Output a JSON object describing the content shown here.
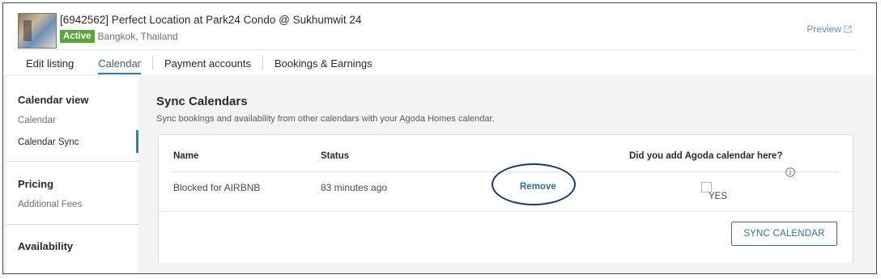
{
  "listing": {
    "title": "[6942562] Perfect Location at Park24 Condo @ Sukhumwit 24",
    "status_badge": "Active",
    "location": "Bangkok, Thailand",
    "preview_label": "Preview"
  },
  "tabs": [
    {
      "label": "Edit listing"
    },
    {
      "label": "Calendar"
    },
    {
      "label": "Payment accounts"
    },
    {
      "label": "Bookings & Earnings"
    }
  ],
  "sidebar": {
    "calendar_view": {
      "heading": "Calendar view",
      "items": [
        "Calendar",
        "Calendar Sync"
      ]
    },
    "pricing": {
      "heading": "Pricing",
      "items": [
        "Additional Fees"
      ]
    },
    "availability": {
      "heading": "Availability"
    }
  },
  "main": {
    "title": "Sync Calendars",
    "description": "Sync bookings and availability from other calendars with your Agoda Homes calendar.",
    "table": {
      "headers": {
        "name": "Name",
        "status": "Status",
        "added": "Did you add Agoda calendar here?"
      },
      "rows": [
        {
          "name": "Blocked for AIRBNB",
          "status": "83 minutes ago",
          "action": "Remove",
          "checkbox_label": "YES",
          "checked": false
        }
      ]
    },
    "sync_button": "SYNC CALENDAR"
  },
  "colors": {
    "accent": "#3a7ba8",
    "active_badge": "#58a53b",
    "link": "#2f6d9c",
    "annotation_circle": "#1f3a6a"
  }
}
